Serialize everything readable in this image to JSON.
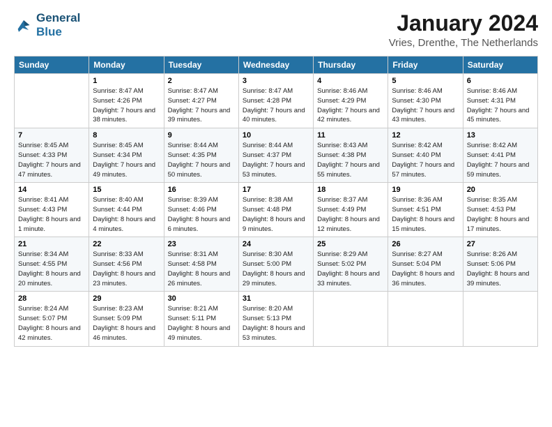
{
  "logo": {
    "line1": "General",
    "line2": "Blue"
  },
  "title": "January 2024",
  "subtitle": "Vries, Drenthe, The Netherlands",
  "days_of_week": [
    "Sunday",
    "Monday",
    "Tuesday",
    "Wednesday",
    "Thursday",
    "Friday",
    "Saturday"
  ],
  "weeks": [
    [
      {
        "num": "",
        "sunrise": "",
        "sunset": "",
        "daylight": ""
      },
      {
        "num": "1",
        "sunrise": "Sunrise: 8:47 AM",
        "sunset": "Sunset: 4:26 PM",
        "daylight": "Daylight: 7 hours and 38 minutes."
      },
      {
        "num": "2",
        "sunrise": "Sunrise: 8:47 AM",
        "sunset": "Sunset: 4:27 PM",
        "daylight": "Daylight: 7 hours and 39 minutes."
      },
      {
        "num": "3",
        "sunrise": "Sunrise: 8:47 AM",
        "sunset": "Sunset: 4:28 PM",
        "daylight": "Daylight: 7 hours and 40 minutes."
      },
      {
        "num": "4",
        "sunrise": "Sunrise: 8:46 AM",
        "sunset": "Sunset: 4:29 PM",
        "daylight": "Daylight: 7 hours and 42 minutes."
      },
      {
        "num": "5",
        "sunrise": "Sunrise: 8:46 AM",
        "sunset": "Sunset: 4:30 PM",
        "daylight": "Daylight: 7 hours and 43 minutes."
      },
      {
        "num": "6",
        "sunrise": "Sunrise: 8:46 AM",
        "sunset": "Sunset: 4:31 PM",
        "daylight": "Daylight: 7 hours and 45 minutes."
      }
    ],
    [
      {
        "num": "7",
        "sunrise": "Sunrise: 8:45 AM",
        "sunset": "Sunset: 4:33 PM",
        "daylight": "Daylight: 7 hours and 47 minutes."
      },
      {
        "num": "8",
        "sunrise": "Sunrise: 8:45 AM",
        "sunset": "Sunset: 4:34 PM",
        "daylight": "Daylight: 7 hours and 49 minutes."
      },
      {
        "num": "9",
        "sunrise": "Sunrise: 8:44 AM",
        "sunset": "Sunset: 4:35 PM",
        "daylight": "Daylight: 7 hours and 50 minutes."
      },
      {
        "num": "10",
        "sunrise": "Sunrise: 8:44 AM",
        "sunset": "Sunset: 4:37 PM",
        "daylight": "Daylight: 7 hours and 53 minutes."
      },
      {
        "num": "11",
        "sunrise": "Sunrise: 8:43 AM",
        "sunset": "Sunset: 4:38 PM",
        "daylight": "Daylight: 7 hours and 55 minutes."
      },
      {
        "num": "12",
        "sunrise": "Sunrise: 8:42 AM",
        "sunset": "Sunset: 4:40 PM",
        "daylight": "Daylight: 7 hours and 57 minutes."
      },
      {
        "num": "13",
        "sunrise": "Sunrise: 8:42 AM",
        "sunset": "Sunset: 4:41 PM",
        "daylight": "Daylight: 7 hours and 59 minutes."
      }
    ],
    [
      {
        "num": "14",
        "sunrise": "Sunrise: 8:41 AM",
        "sunset": "Sunset: 4:43 PM",
        "daylight": "Daylight: 8 hours and 1 minute."
      },
      {
        "num": "15",
        "sunrise": "Sunrise: 8:40 AM",
        "sunset": "Sunset: 4:44 PM",
        "daylight": "Daylight: 8 hours and 4 minutes."
      },
      {
        "num": "16",
        "sunrise": "Sunrise: 8:39 AM",
        "sunset": "Sunset: 4:46 PM",
        "daylight": "Daylight: 8 hours and 6 minutes."
      },
      {
        "num": "17",
        "sunrise": "Sunrise: 8:38 AM",
        "sunset": "Sunset: 4:48 PM",
        "daylight": "Daylight: 8 hours and 9 minutes."
      },
      {
        "num": "18",
        "sunrise": "Sunrise: 8:37 AM",
        "sunset": "Sunset: 4:49 PM",
        "daylight": "Daylight: 8 hours and 12 minutes."
      },
      {
        "num": "19",
        "sunrise": "Sunrise: 8:36 AM",
        "sunset": "Sunset: 4:51 PM",
        "daylight": "Daylight: 8 hours and 15 minutes."
      },
      {
        "num": "20",
        "sunrise": "Sunrise: 8:35 AM",
        "sunset": "Sunset: 4:53 PM",
        "daylight": "Daylight: 8 hours and 17 minutes."
      }
    ],
    [
      {
        "num": "21",
        "sunrise": "Sunrise: 8:34 AM",
        "sunset": "Sunset: 4:55 PM",
        "daylight": "Daylight: 8 hours and 20 minutes."
      },
      {
        "num": "22",
        "sunrise": "Sunrise: 8:33 AM",
        "sunset": "Sunset: 4:56 PM",
        "daylight": "Daylight: 8 hours and 23 minutes."
      },
      {
        "num": "23",
        "sunrise": "Sunrise: 8:31 AM",
        "sunset": "Sunset: 4:58 PM",
        "daylight": "Daylight: 8 hours and 26 minutes."
      },
      {
        "num": "24",
        "sunrise": "Sunrise: 8:30 AM",
        "sunset": "Sunset: 5:00 PM",
        "daylight": "Daylight: 8 hours and 29 minutes."
      },
      {
        "num": "25",
        "sunrise": "Sunrise: 8:29 AM",
        "sunset": "Sunset: 5:02 PM",
        "daylight": "Daylight: 8 hours and 33 minutes."
      },
      {
        "num": "26",
        "sunrise": "Sunrise: 8:27 AM",
        "sunset": "Sunset: 5:04 PM",
        "daylight": "Daylight: 8 hours and 36 minutes."
      },
      {
        "num": "27",
        "sunrise": "Sunrise: 8:26 AM",
        "sunset": "Sunset: 5:06 PM",
        "daylight": "Daylight: 8 hours and 39 minutes."
      }
    ],
    [
      {
        "num": "28",
        "sunrise": "Sunrise: 8:24 AM",
        "sunset": "Sunset: 5:07 PM",
        "daylight": "Daylight: 8 hours and 42 minutes."
      },
      {
        "num": "29",
        "sunrise": "Sunrise: 8:23 AM",
        "sunset": "Sunset: 5:09 PM",
        "daylight": "Daylight: 8 hours and 46 minutes."
      },
      {
        "num": "30",
        "sunrise": "Sunrise: 8:21 AM",
        "sunset": "Sunset: 5:11 PM",
        "daylight": "Daylight: 8 hours and 49 minutes."
      },
      {
        "num": "31",
        "sunrise": "Sunrise: 8:20 AM",
        "sunset": "Sunset: 5:13 PM",
        "daylight": "Daylight: 8 hours and 53 minutes."
      },
      {
        "num": "",
        "sunrise": "",
        "sunset": "",
        "daylight": ""
      },
      {
        "num": "",
        "sunrise": "",
        "sunset": "",
        "daylight": ""
      },
      {
        "num": "",
        "sunrise": "",
        "sunset": "",
        "daylight": ""
      }
    ]
  ]
}
